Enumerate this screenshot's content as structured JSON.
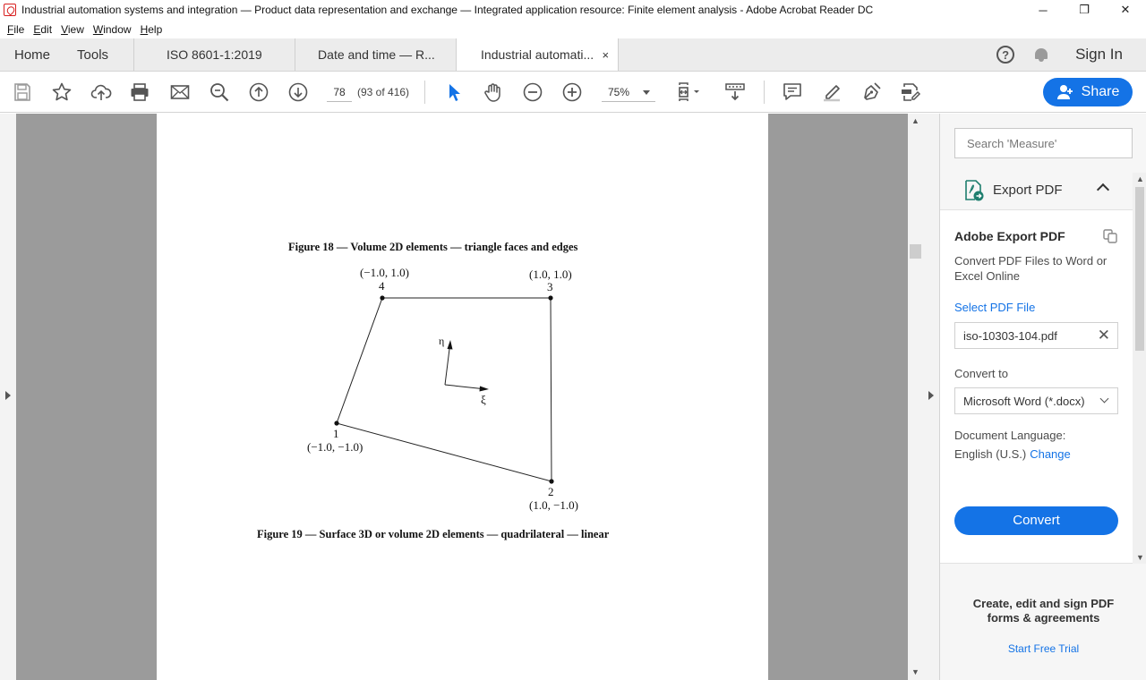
{
  "window": {
    "title": "Industrial automation systems and integration — Product data representation and exchange — Integrated application resource: Finite element analysis - Adobe Acrobat Reader DC",
    "minimize": "─",
    "restore": "❐",
    "close": "✕"
  },
  "menu": [
    "File",
    "Edit",
    "View",
    "Window",
    "Help"
  ],
  "tabs": {
    "home": "Home",
    "tools": "Tools",
    "docs": [
      {
        "label": "ISO 8601-1:2019"
      },
      {
        "label": "Date and time — R..."
      },
      {
        "label": "Industrial automati..."
      }
    ],
    "close_glyph": "×",
    "help_glyph": "?",
    "sign_in": "Sign In"
  },
  "toolbar": {
    "page_number": "78",
    "page_count": "(93 of 416)",
    "zoom": "75%",
    "share": "Share",
    "icons": [
      "save-icon",
      "star-icon",
      "upload-icon",
      "print-icon",
      "email-icon",
      "zoom-search-icon",
      "page-up-icon",
      "page-down-icon",
      "select-cursor-icon",
      "hand-icon",
      "zoom-out-icon",
      "zoom-in-icon",
      "fit-page-icon",
      "scroll-mode-icon",
      "comment-icon",
      "highlight-icon",
      "sign-icon",
      "edit-pdf-icon"
    ]
  },
  "document": {
    "figure18_caption": "Figure 18 — Volume 2D elements — triangle faces and edges",
    "figure19_caption": "Figure 19 — Surface 3D or volume 2D elements — quadrilateral — linear",
    "nodes": [
      {
        "id": "1",
        "coord": "(−1.0, −1.0)"
      },
      {
        "id": "2",
        "coord": "(1.0, −1.0)"
      },
      {
        "id": "3",
        "coord": "(1.0, 1.0)"
      },
      {
        "id": "4",
        "coord": "(−1.0, 1.0)"
      }
    ],
    "axis_eta": "η",
    "axis_xi": "ξ"
  },
  "panel": {
    "search_placeholder": "Search 'Measure'",
    "export_header": "Export PDF",
    "export_title": "Adobe Export PDF",
    "export_desc": "Convert PDF Files to Word or Excel Online",
    "select_file": "Select PDF File",
    "file_name": "iso-10303-104.pdf",
    "convert_to_label": "Convert to",
    "format": "Microsoft Word (*.docx)",
    "language_label": "Document Language:",
    "language_value": "English (U.S.)",
    "change": "Change",
    "convert_button": "Convert",
    "promo_text": "Create, edit and sign PDF forms & agreements",
    "promo_link": "Start Free Trial"
  },
  "colors": {
    "accent": "#1473e6",
    "doc_background": "#9b9b9b",
    "brand_red": "#d81f1f"
  }
}
